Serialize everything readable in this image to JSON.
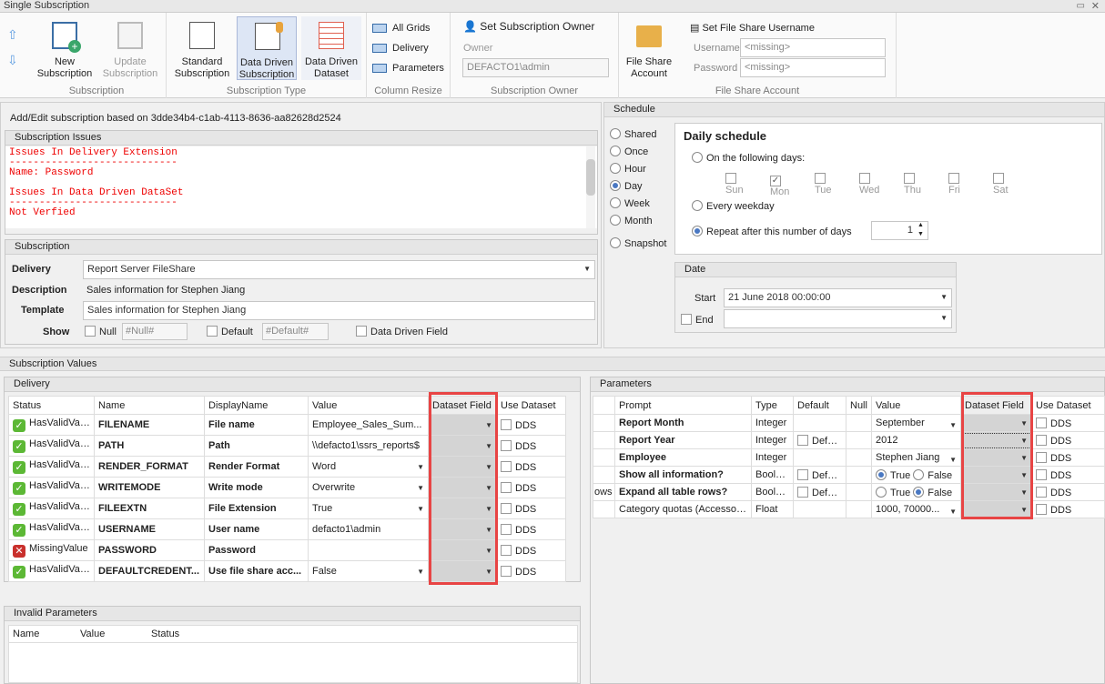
{
  "window": {
    "title": "Single Subscription"
  },
  "ribbon": {
    "new_subscription": "New Subscription",
    "update_subscription": "Update Subscription",
    "group_subscription": "Subscription",
    "standard_subscription": "Standard Subscription",
    "data_driven_subscription": "Data Driven Subscription",
    "data_driven_dataset": "Data Driven Dataset",
    "group_subscription_type": "Subscription Type",
    "all_grids": "All Grids",
    "delivery": "Delivery",
    "parameters": "Parameters",
    "group_column_resize": "Column Resize",
    "set_owner": "Set Subscription Owner",
    "owner_label": "Owner",
    "owner_value": "DEFACTO1\\admin",
    "group_owner": "Subscription Owner",
    "file_share_account": "File Share Account",
    "set_username": "Set File Share Username",
    "username_label": "Username",
    "username_value": "<missing>",
    "password_label": "Password",
    "password_value": "<missing>",
    "group_file_share": "File Share Account"
  },
  "header": "Add/Edit subscription based on 3dde34b4-c1ab-4113-8636-aa82628d2524",
  "issues": {
    "title": "Subscription Issues",
    "lines": [
      "Issues In Delivery Extension",
      "----------------------------",
      "Name: Password",
      "",
      "Issues In Data Driven DataSet",
      "----------------------------",
      "Not Verfied"
    ]
  },
  "subscription": {
    "title": "Subscription",
    "delivery_label": "Delivery",
    "delivery_value": "Report Server FileShare",
    "description_label": "Description",
    "description_value": "Sales information for Stephen Jiang",
    "template_label": "Template",
    "template_value": "Sales information for Stephen Jiang",
    "show_label": "Show",
    "null_label": "Null",
    "null_placeholder": "#Null#",
    "default_label": "Default",
    "default_placeholder": "#Default#",
    "ddf_label": "Data Driven Field"
  },
  "schedule": {
    "title": "Schedule",
    "options": [
      {
        "label": "Shared",
        "on": false
      },
      {
        "label": "Once",
        "on": false
      },
      {
        "label": "Hour",
        "on": false
      },
      {
        "label": "Day",
        "on": true
      },
      {
        "label": "Week",
        "on": false
      },
      {
        "label": "Month",
        "on": false
      },
      {
        "label": "Snapshot",
        "on": false
      }
    ],
    "daily_title": "Daily schedule",
    "following_days": "On the following days:",
    "days": [
      {
        "d": "Sun",
        "on": false
      },
      {
        "d": "Mon",
        "on": true
      },
      {
        "d": "Tue",
        "on": false
      },
      {
        "d": "Wed",
        "on": false
      },
      {
        "d": "Thu",
        "on": false
      },
      {
        "d": "Fri",
        "on": false
      },
      {
        "d": "Sat",
        "on": false
      }
    ],
    "every_weekday": "Every weekday",
    "repeat": "Repeat after this number of days",
    "repeat_value": "1",
    "date_title": "Date",
    "start_label": "Start",
    "start_value": "21 June 2018 00:00:00",
    "end_label": "End"
  },
  "values_title": "Subscription Values",
  "delivery": {
    "title": "Delivery",
    "columns": [
      "Status",
      "Name",
      "DisplayName",
      "Value",
      "Dataset Field",
      "Use Dataset"
    ],
    "rows": [
      {
        "status": "HasValidValue",
        "ok": true,
        "name": "FILENAME",
        "display": "File name",
        "value": "Employee_Sales_Sum...",
        "dd": false
      },
      {
        "status": "HasValidValue",
        "ok": true,
        "name": "PATH",
        "display": "Path",
        "value": "\\\\defacto1\\ssrs_reports$",
        "dd": false
      },
      {
        "status": "HasValidValue",
        "ok": true,
        "name": "RENDER_FORMAT",
        "display": "Render Format",
        "value": "Word",
        "dd": true
      },
      {
        "status": "HasValidValue",
        "ok": true,
        "name": "WRITEMODE",
        "display": "Write mode",
        "value": "Overwrite",
        "dd": true
      },
      {
        "status": "HasValidValue",
        "ok": true,
        "name": "FILEEXTN",
        "display": "File Extension",
        "value": "True",
        "dd": true
      },
      {
        "status": "HasValidValue",
        "ok": true,
        "name": "USERNAME",
        "display": "User name",
        "value": "defacto1\\admin",
        "dd": false
      },
      {
        "status": "MissingValue",
        "ok": false,
        "name": "PASSWORD",
        "display": "Password",
        "value": "",
        "dd": false
      },
      {
        "status": "HasValidValue",
        "ok": true,
        "name": "DEFAULTCREDENT...",
        "display": "Use file share acc...",
        "value": "False",
        "dd": true
      }
    ],
    "dds": "DDS"
  },
  "invalid": {
    "title": "Invalid Parameters",
    "columns": [
      "Name",
      "Value",
      "Status"
    ]
  },
  "parameters": {
    "title": "Parameters",
    "columns": [
      "",
      "Prompt",
      "Type",
      "Default",
      "Null",
      "Value",
      "Dataset Field",
      "Use Dataset"
    ],
    "rows": [
      {
        "c0": "",
        "prompt": "Report Month",
        "bold": true,
        "type": "Integer",
        "def": false,
        "value": "September",
        "kind": "dd"
      },
      {
        "c0": "",
        "prompt": "Report Year",
        "bold": true,
        "type": "Integer",
        "def": true,
        "value": "2012",
        "kind": "text"
      },
      {
        "c0": "",
        "prompt": "Employee",
        "bold": true,
        "type": "Integer",
        "def": false,
        "value": "Stephen Jiang",
        "kind": "dd"
      },
      {
        "c0": "",
        "prompt": "Show all information?",
        "bold": true,
        "type": "Boolean",
        "def": true,
        "value": "True",
        "kind": "bool"
      },
      {
        "c0": "ows",
        "prompt": "Expand all table rows?",
        "bold": true,
        "type": "Boolean",
        "def": true,
        "value": "False",
        "kind": "bool"
      },
      {
        "c0": "",
        "prompt": "Category quotas (Accessori...",
        "bold": false,
        "type": "Float",
        "def": false,
        "value": "1000, 70000...",
        "kind": "dd"
      }
    ],
    "default_label": "Default",
    "true_label": "True",
    "false_label": "False",
    "dds": "DDS"
  },
  "colors": {
    "highlight": "#e84444",
    "error": "#ee0000",
    "selected": "#dde6f5"
  }
}
